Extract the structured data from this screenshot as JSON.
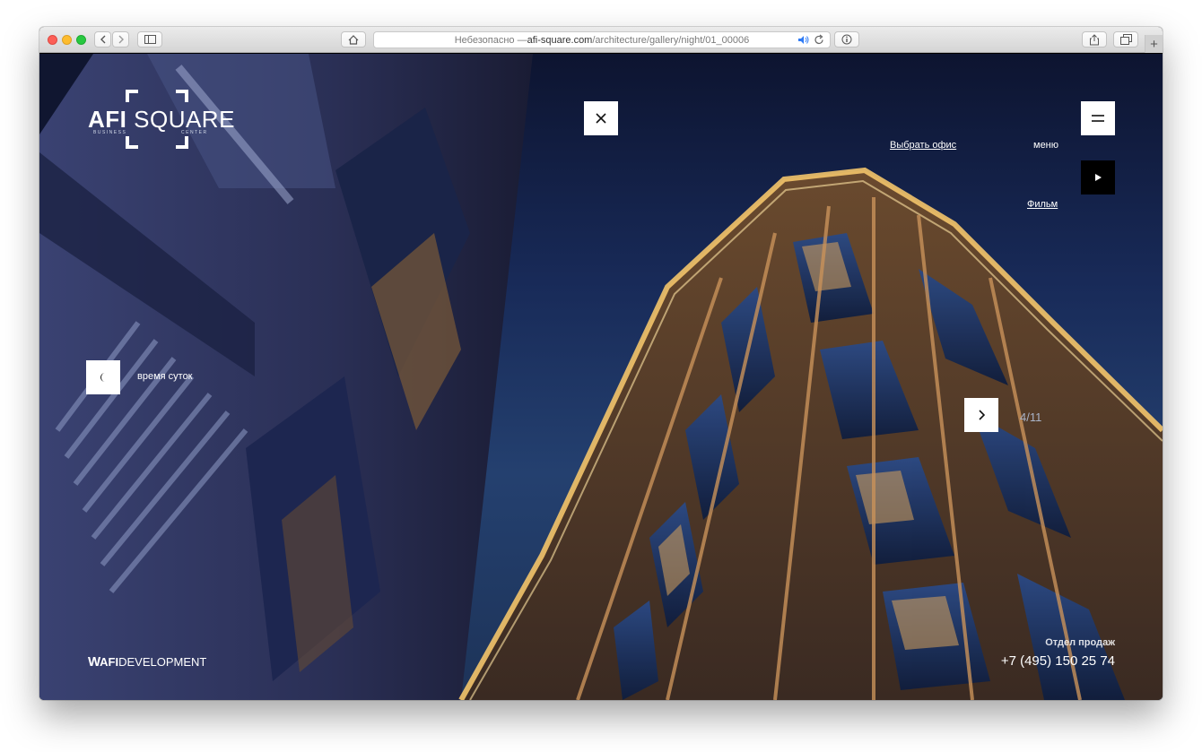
{
  "browser": {
    "url_prefix": "Небезопасно — ",
    "url_host": "afi-square.com",
    "url_path": "/architecture/gallery/night/01_00006",
    "tab_add_label": "+"
  },
  "site": {
    "logo": {
      "bold": "AFI",
      "light": "SQUARE",
      "sub_left": "BUSINESS",
      "sub_right": "CENTER"
    },
    "choose_office_link": "Выбрать офис",
    "menu_label": "меню",
    "film_link": "Фильм",
    "time_of_day_label": "время суток",
    "gallery_counter": "4/11",
    "developer": {
      "bold": "AFI",
      "light": "DEVELOPMENT"
    },
    "sales": {
      "title": "Отдел продаж",
      "phone": "+7 (495) 150 25 74"
    }
  },
  "colors": {
    "sky_dark": "#0d1430",
    "sky_mid": "#24406f",
    "facade_glow": "#f3c46a"
  }
}
